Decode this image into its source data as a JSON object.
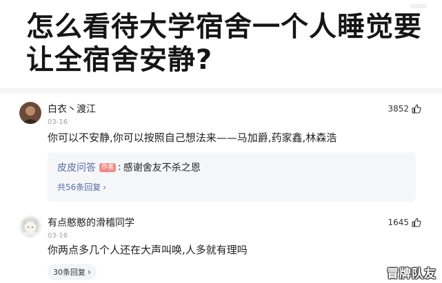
{
  "question": {
    "title": "怎么看待大学宿舍一个人睡觉要让全宿舍安静?"
  },
  "comments": [
    {
      "username": "白衣丶渡江",
      "date": "03-16",
      "likes": "3852",
      "text": "你可以不安静,你可以按照自己想法来——马加爵,药家鑫,林森浩",
      "reply_preview": {
        "author": "皮皮问答",
        "badge": "作者",
        "separator": ":",
        "text": "感谢舍友不杀之恩"
      },
      "reply_count": "共56条回复",
      "reply_chevron": "›"
    },
    {
      "username": "有点憨憨的滑稽同学",
      "date": "03-16",
      "likes": "1645",
      "text": "你两点多几个人还在大声叫唤,人多就有理吗",
      "reply_count": "30条回复",
      "reply_chevron": "›"
    }
  ],
  "watermark": "冒牌队友",
  "icons": {
    "like": "thumbs-up-icon"
  },
  "colors": {
    "link": "#5a6ea8",
    "badge": "#f08a8a",
    "reply_bg": "#f5f6f8"
  }
}
